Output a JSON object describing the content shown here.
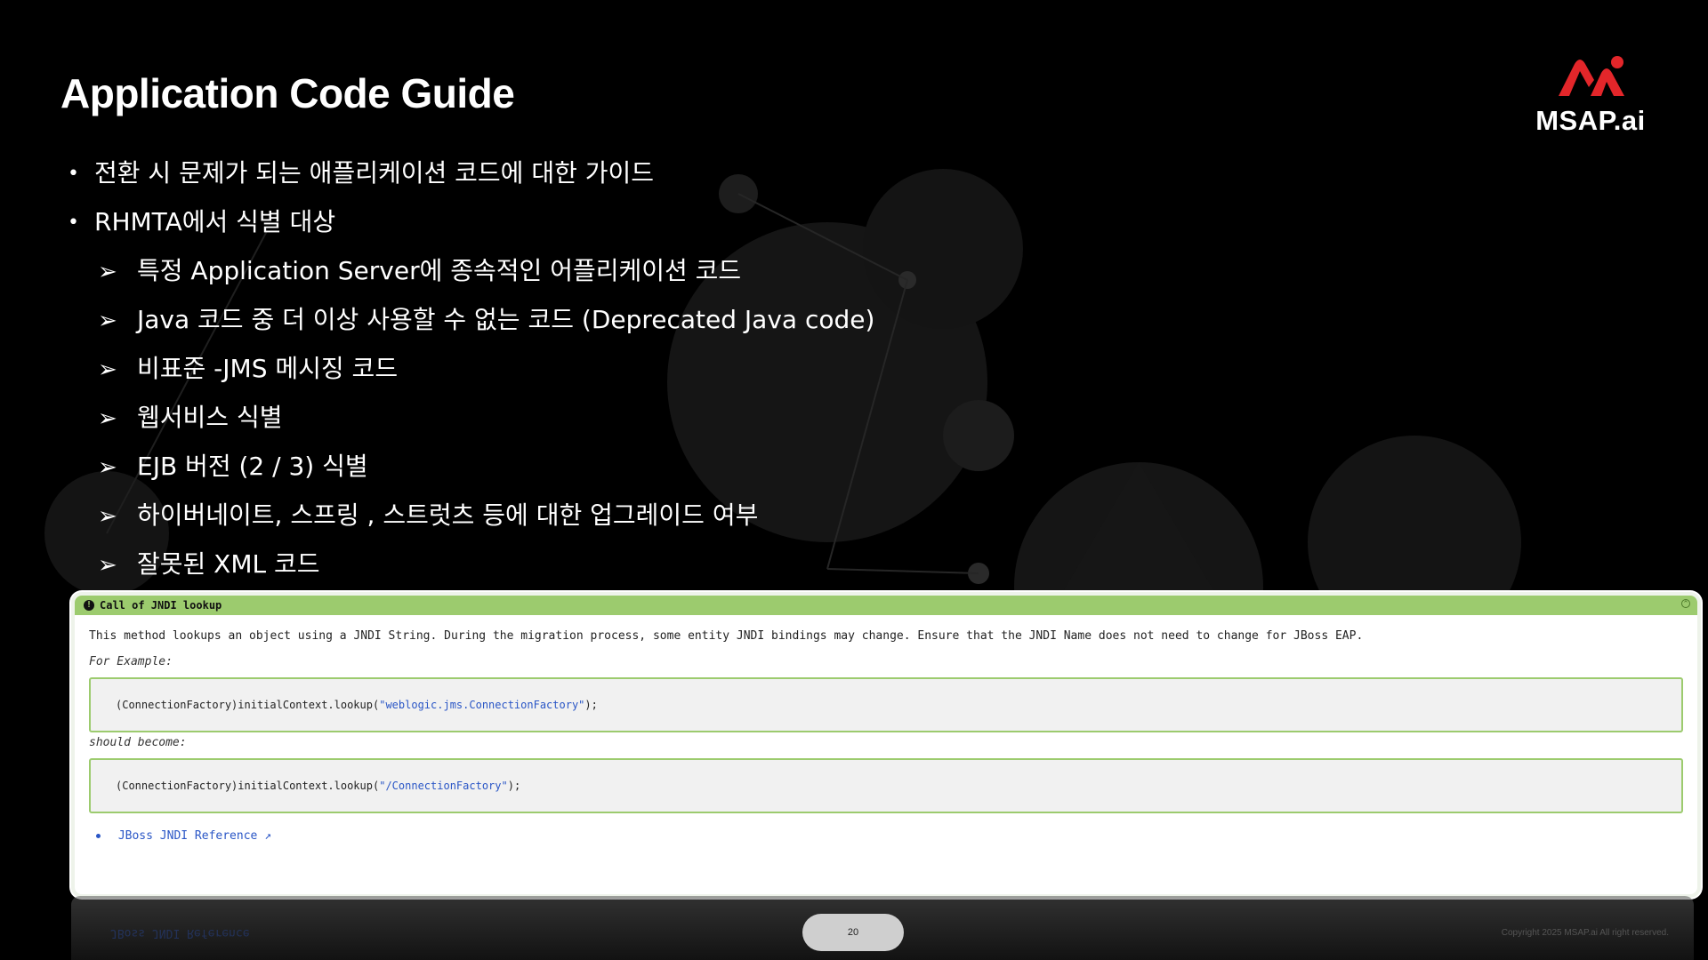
{
  "slide": {
    "title": "Application Code Guide",
    "logo_text": "MSAP.ai",
    "bullets": [
      "전환 시 문제가 되는 애플리케이션 코드에 대한 가이드",
      "RHMTA에서 식별 대상"
    ],
    "sub_bullets": [
      "특정 Application Server에 종속적인  어플리케이션 코드",
      "Java 코드 중 더 이상 사용할 수 없는 코드 (Deprecated Java code)",
      "비표준 -JMS 메시징 코드",
      "웹서비스 식별",
      "EJB 버전 (2 / 3) 식별",
      "하이버네이트, 스프링 , 스트럿츠 등에 대한 업그레이드 여부",
      "잘못된 XML 코드"
    ],
    "bullet_mark": "•",
    "sub_bullet_mark": "➢",
    "page_number": "20",
    "copyright": "Copyright 2025 MSAP.ai All right reserved."
  },
  "panel": {
    "header": "Call of JNDI lookup",
    "info_mark": "!",
    "collapse_mark": "^",
    "description": "This method lookups an object using a JNDI String. During the migration process, some entity JNDI bindings may change. Ensure that the JNDI Name does not need to change for JBoss EAP.",
    "example_label": "For Example:",
    "code_before_prefix": "(ConnectionFactory)initialContext.lookup(",
    "code_before_string": "\"weblogic.jms.ConnectionFactory\"",
    "code_before_suffix": ");",
    "become_label": "should become:",
    "code_after_prefix": "(ConnectionFactory)initialContext.lookup(",
    "code_after_string": "\"/ConnectionFactory\"",
    "code_after_suffix": ");",
    "reference_link": "JBoss JNDI Reference",
    "external_mark": "↗"
  },
  "colors": {
    "background": "#000000",
    "panel_header": "#9ccb6e",
    "logo_red": "#e3262a",
    "link_blue": "#2a56c6"
  }
}
